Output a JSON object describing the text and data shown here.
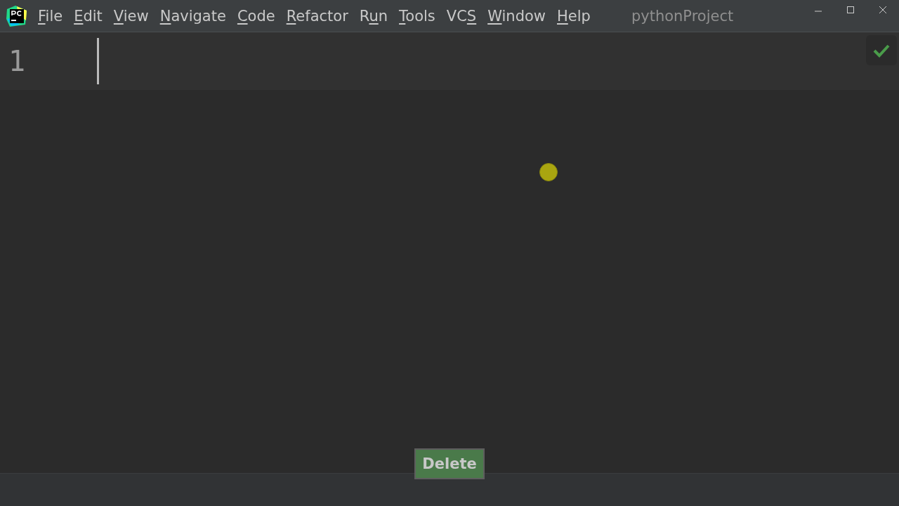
{
  "menu": [
    {
      "key": "F",
      "post": "ile"
    },
    {
      "key": "E",
      "post": "dit"
    },
    {
      "key": "V",
      "post": "iew"
    },
    {
      "key": "N",
      "post": "avigate"
    },
    {
      "key": "C",
      "post": "ode"
    },
    {
      "key": "R",
      "post": "efactor"
    },
    {
      "pre": "R",
      "key": "u",
      "post": "n"
    },
    {
      "key": "T",
      "post": "ools"
    },
    {
      "pre": "VC",
      "key": "S"
    },
    {
      "key": "W",
      "post": "indow"
    },
    {
      "key": "H",
      "post": "elp"
    }
  ],
  "window": {
    "title": "pythonProject"
  },
  "editor": {
    "line_number": "1"
  },
  "button": {
    "label": "Delete"
  }
}
